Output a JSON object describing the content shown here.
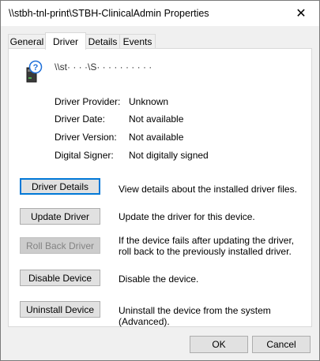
{
  "window": {
    "title": "\\\\stbh-tnl-print\\STBH-ClinicalAdmin Properties",
    "close_glyph": "✕"
  },
  "tabs": [
    {
      "label": "General",
      "active": false
    },
    {
      "label": "Driver",
      "active": true
    },
    {
      "label": "Details",
      "active": false
    },
    {
      "label": "Events",
      "active": false
    }
  ],
  "device": {
    "name": "\\\\st·  ·  ·  ·\\S· · · · · · · · · ·",
    "icon": "printer-question-icon"
  },
  "properties": [
    {
      "label": "Driver Provider:",
      "value": "Unknown"
    },
    {
      "label": "Driver Date:",
      "value": "Not available"
    },
    {
      "label": "Driver Version:",
      "value": "Not available"
    },
    {
      "label": "Digital Signer:",
      "value": "Not digitally signed"
    }
  ],
  "actions": [
    {
      "label": "Driver Details",
      "desc": "View details about the installed driver files.",
      "enabled": true,
      "focused": true
    },
    {
      "label": "Update Driver",
      "desc": "Update the driver for this device.",
      "enabled": true,
      "focused": false
    },
    {
      "label": "Roll Back Driver",
      "desc": "If the device fails after updating the driver, roll back to the previously installed driver.",
      "enabled": false,
      "focused": false
    },
    {
      "label": "Disable Device",
      "desc": "Disable the device.",
      "enabled": true,
      "focused": false
    },
    {
      "label": "Uninstall Device",
      "desc": "Uninstall the device from the system (Advanced).",
      "enabled": true,
      "focused": false
    }
  ],
  "footer": {
    "ok_label": "OK",
    "cancel_label": "Cancel"
  },
  "colors": {
    "focus": "#0078d7",
    "button_bg": "#e1e1e1",
    "disabled_text": "#838383"
  }
}
